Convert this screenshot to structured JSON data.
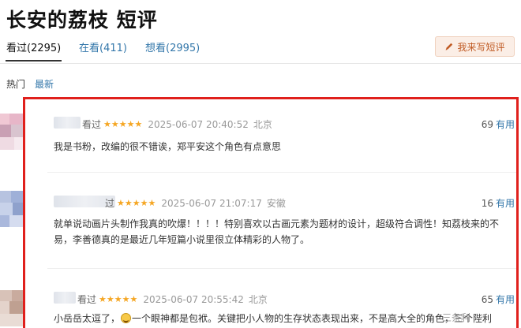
{
  "page": {
    "title": "长安的荔枝 短评"
  },
  "tabs": [
    {
      "label": "看过(2295)",
      "active": true
    },
    {
      "label": "在看(411)",
      "active": false
    },
    {
      "label": "想看(2995)",
      "active": false
    }
  ],
  "write_button": {
    "label": "我来写短评",
    "icon": "pencil-icon"
  },
  "sort": {
    "hot": "热门",
    "newest": "最新"
  },
  "comments": [
    {
      "status": "看过",
      "rating_stars": 5,
      "time": "2025-06-07 20:40:52",
      "location": "北京",
      "votes": "69",
      "vote_label": "有用",
      "text": "我是书粉，改编的很不错诶，郑平安这个角色有点意思"
    },
    {
      "status": "过",
      "rating_stars": 5,
      "time": "2025-06-07 21:07:17",
      "location": "安徽",
      "votes": "16",
      "vote_label": "有用",
      "text": "就单说动画片头制作我真的吹爆！！！！特别喜欢以古画元素为题材的设计，超级符合调性！知荔枝来的不易，李善德真的是最近几年短篇小说里很立体精彩的人物了。"
    },
    {
      "status": "看过",
      "rating_stars": 5,
      "time": "2025-06-07 20:55:42",
      "location": "北京",
      "votes": "65",
      "vote_label": "有用",
      "text_before": "小岳岳太逗了，",
      "text_after": "一个眼神都是包袱。关键把小人物的生存状态表现出来，不是高大全的角色，三个陛利"
    }
  ],
  "watermark": "三条利",
  "colors": {
    "link": "#3377aa",
    "star": "#f5a623",
    "highlight_border": "#e0201c",
    "write_button_bg": "#fbeee6",
    "write_button_text": "#c05a23"
  }
}
